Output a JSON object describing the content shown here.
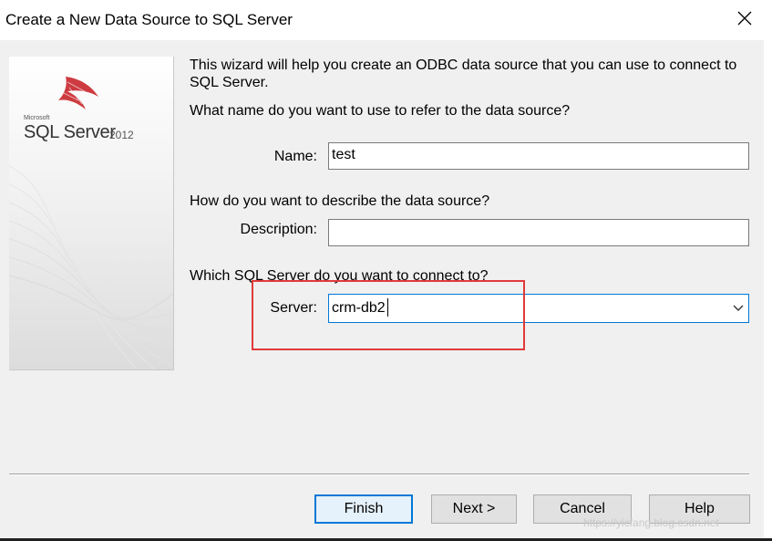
{
  "window": {
    "title": "Create a New Data Source to SQL Server"
  },
  "logo": {
    "microsoft": "Microsoft",
    "product": "SQL Server",
    "year": "2012"
  },
  "intro": {
    "line1": "This wizard will help you create an ODBC data source that you can use to connect to",
    "line2": "SQL Server."
  },
  "name_section": {
    "question": "What name do you want to use to refer to the data source?",
    "label": "Name:",
    "value": "test"
  },
  "description_section": {
    "question": "How do you want to describe the data source?",
    "label": "Description:",
    "value": ""
  },
  "server_section": {
    "question": "Which SQL Server do you want to connect to?",
    "label": "Server:",
    "value": "crm-db2"
  },
  "buttons": {
    "finish": "Finish",
    "next": "Next >",
    "cancel": "Cancel",
    "help": "Help"
  },
  "watermark": "https://yicfang.blog.csdn.net",
  "colors": {
    "highlight": "#e03a3a",
    "focus": "#0078d7",
    "logo_red": "#c8262c"
  }
}
